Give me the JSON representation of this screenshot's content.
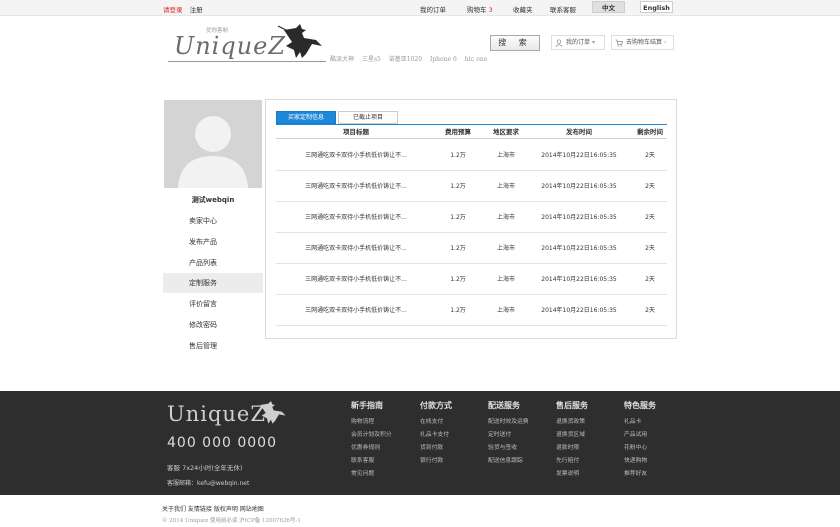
{
  "topbar": {
    "login": "请登录",
    "register": "注册",
    "nav": [
      {
        "label": "我的订单"
      },
      {
        "label": "购物车",
        "badge": "3"
      },
      {
        "label": "收藏夹"
      },
      {
        "label": "联系客服"
      }
    ],
    "lang_cn": "中文",
    "lang_en": "English"
  },
  "header": {
    "logo": "UniqueZ",
    "logo_tagline": "优你客制",
    "hotwords": [
      "酷派大神",
      "三星s5",
      "诺基亚1020",
      "Iphone 6",
      "htc one"
    ],
    "search_label": "搜 索",
    "my_order": "我的订单",
    "cart": "去购物车结算"
  },
  "sidebar": {
    "username": "测试webqin",
    "menu": [
      "卖家中心",
      "发布产品",
      "产品列表",
      "定制服务",
      "评价留言",
      "修改密码",
      "售后管理"
    ],
    "active_index": 3
  },
  "content": {
    "tabs": [
      "买家定制信息",
      "已截止项目"
    ],
    "columns": [
      "项目标题",
      "费用预算",
      "地区要求",
      "发布时间",
      "剩余时间"
    ],
    "rows": [
      {
        "title": "三网通吃双卡双待小手机低价铸让不...",
        "budget": "1.2万",
        "region": "上海市",
        "time": "2014年10月22日16:05:35",
        "left": "2天"
      },
      {
        "title": "三网通吃双卡双待小手机低价铸让不...",
        "budget": "1.2万",
        "region": "上海市",
        "time": "2014年10月22日16:05:35",
        "left": "2天"
      },
      {
        "title": "三网通吃双卡双待小手机低价铸让不...",
        "budget": "1.2万",
        "region": "上海市",
        "time": "2014年10月22日16:05:35",
        "left": "2天"
      },
      {
        "title": "三网通吃双卡双待小手机低价铸让不...",
        "budget": "1.2万",
        "region": "上海市",
        "time": "2014年10月22日16:05:35",
        "left": "2天"
      },
      {
        "title": "三网通吃双卡双待小手机低价铸让不...",
        "budget": "1.2万",
        "region": "上海市",
        "time": "2014年10月22日16:05:35",
        "left": "2天"
      },
      {
        "title": "三网通吃双卡双待小手机低价铸让不...",
        "budget": "1.2万",
        "region": "上海市",
        "time": "2014年10月22日16:05:35",
        "left": "2天"
      }
    ]
  },
  "footer": {
    "logo": "UniqueZ",
    "phone": "400 000 0000",
    "service": "客服 7x24小时(全年无休)",
    "email": "客服邮箱：kefu@webqin.net",
    "columns": [
      {
        "title": "新手指南",
        "items": [
          "购物流程",
          "会员计划及积分",
          "优惠券规则",
          "联系客服",
          "常见问题"
        ]
      },
      {
        "title": "付款方式",
        "items": [
          "在线支付",
          "礼品卡支付",
          "货到付款",
          "银行付款"
        ]
      },
      {
        "title": "配送服务",
        "items": [
          "配送时效及运费",
          "定时送付",
          "验货与签收",
          "配送信息跟踪"
        ]
      },
      {
        "title": "售后服务",
        "items": [
          "退换货政策",
          "退换货区域",
          "退款时限",
          "先行赔付",
          "发票说明"
        ]
      },
      {
        "title": "特色服务",
        "items": [
          "礼品卡",
          "产品试用",
          "花粉中心",
          "快递购物",
          "推荐好友"
        ]
      }
    ],
    "bottom_links": "关于我们 友情链接 版权声明 网站地图",
    "copyright": "© 2014 Uniquez 使用前必读 沪ICP备 12007626号-1"
  },
  "colors": {
    "accent_blue": "#1e88d8",
    "login_red": "#d9262d",
    "footer_bg": "#2e2e2e"
  }
}
